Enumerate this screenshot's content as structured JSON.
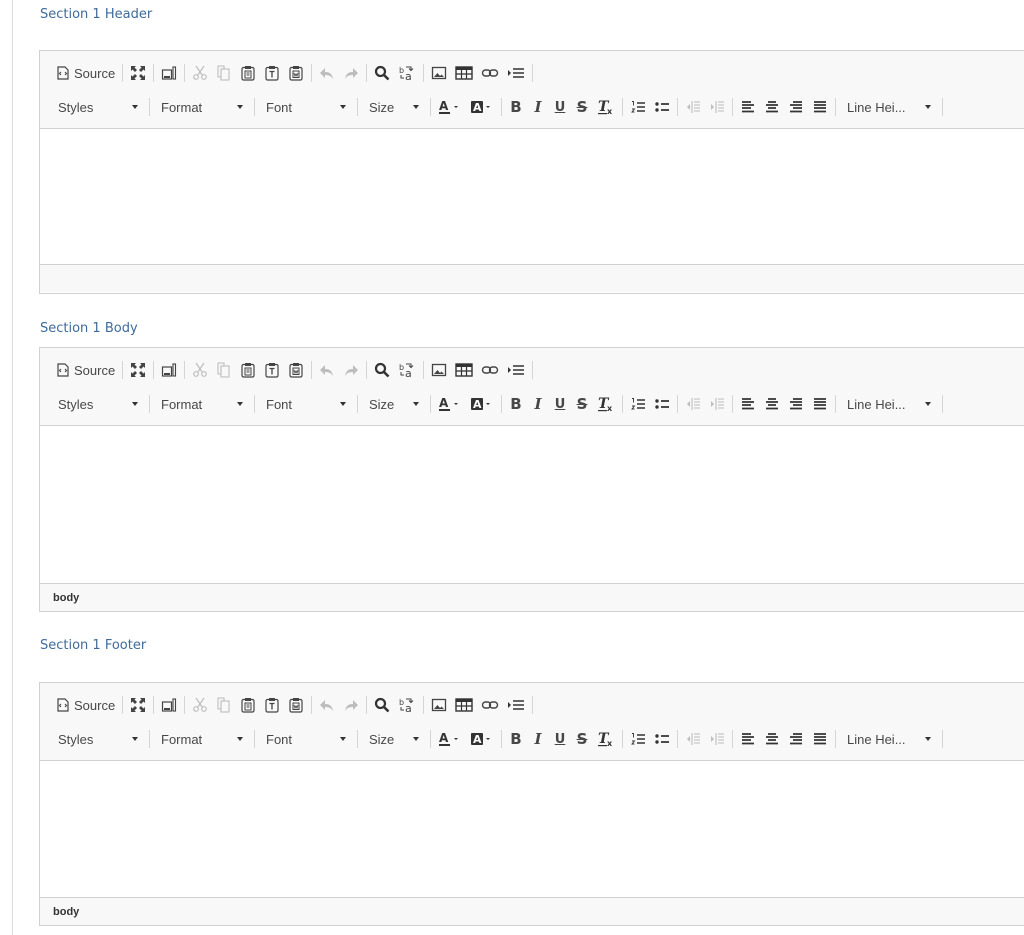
{
  "sections": [
    {
      "label": "Section 1 Header",
      "status": ""
    },
    {
      "label": "Section 1 Body",
      "status": "body"
    },
    {
      "label": "Section 1 Footer",
      "status": "body"
    }
  ],
  "toolbar": {
    "source_label": "Source",
    "styles_label": "Styles",
    "format_label": "Format",
    "font_label": "Font",
    "size_label": "Size",
    "line_height_label": "Line Hei...",
    "bold_glyph": "B",
    "italic_glyph": "I",
    "underline_glyph": "U",
    "strike_glyph": "S"
  },
  "colors": {
    "section_label": "#3e6b9b",
    "toolbar_bg": "#f8f8f8",
    "border": "#d1d1d1"
  }
}
